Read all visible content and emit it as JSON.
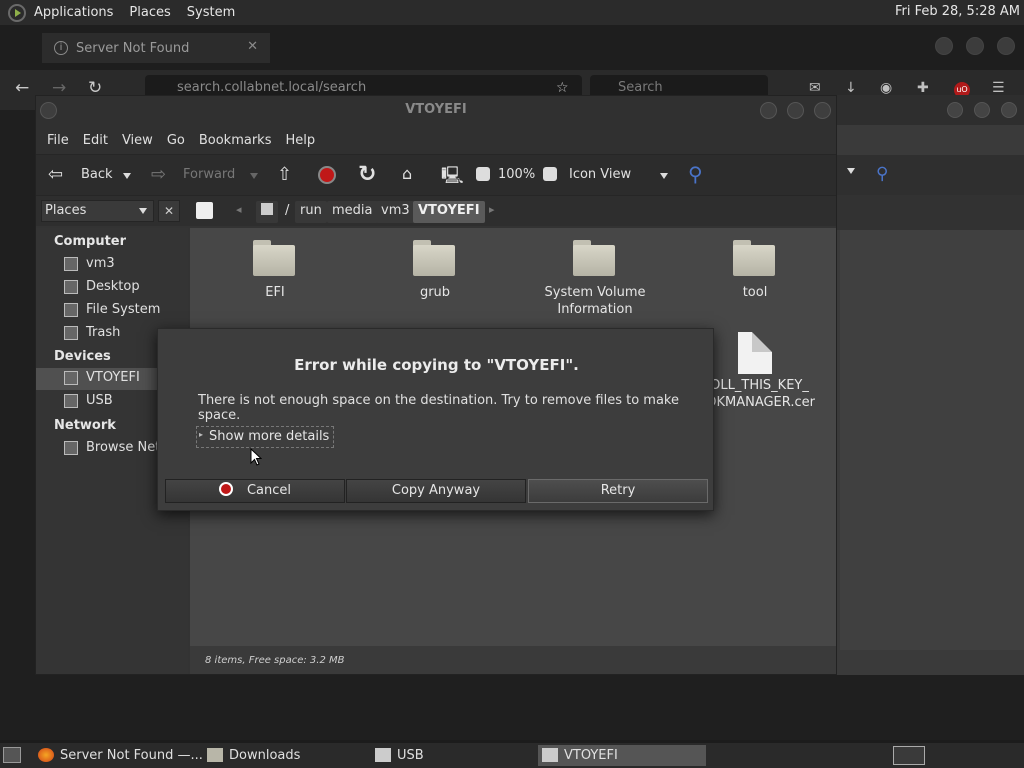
{
  "top_panel": {
    "menus": [
      "Applications",
      "Places",
      "System"
    ],
    "clock": "Fri Feb 28,  5:28 AM"
  },
  "firefox": {
    "tab_title": "Server Not Found",
    "url": "search.collabnet.local/search",
    "search_placeholder": "Search"
  },
  "caja": {
    "title": "VTOYEFI",
    "menu": [
      "File",
      "Edit",
      "View",
      "Go",
      "Bookmarks",
      "Help"
    ],
    "toolbar": {
      "back": "Back",
      "forward": "Forward",
      "zoom": "100%",
      "view_mode": "Icon View"
    },
    "places_select": "Places",
    "breadcrumb": [
      "/",
      "run",
      "media",
      "vm3",
      "VTOYEFI"
    ],
    "sidebar": {
      "computer_header": "Computer",
      "computer_items": [
        "vm3",
        "Desktop",
        "File System",
        "Trash"
      ],
      "devices_header": "Devices",
      "devices_items": [
        "VTOYEFI",
        "USB"
      ],
      "network_header": "Network",
      "network_items": [
        "Browse Net..."
      ]
    },
    "files": [
      "EFI",
      "grub",
      "System Volume Information",
      "tool",
      "ENROLL_THIS_KEY_IN_MOKMANAGER.cer"
    ],
    "file_label_visible": {
      "system_volume_line1": "System Volume",
      "system_volume_line2": "Information",
      "cer_line1": "ROLL_THIS_KEY_",
      "cer_line2": "MOKMANAGER.cer"
    },
    "status": "8 items, Free space: 3.2 MB"
  },
  "dialog": {
    "title": "Error while copying to \"VTOYEFI\".",
    "message": "There is not enough space on the destination. Try to remove files to make space.",
    "details_toggle": "Show more details",
    "buttons": {
      "cancel": "Cancel",
      "copy_anyway": "Copy Anyway",
      "retry": "Retry"
    }
  },
  "taskbar": {
    "items": [
      "Server Not Found —...",
      "Downloads",
      "USB",
      "VTOYEFI"
    ]
  }
}
